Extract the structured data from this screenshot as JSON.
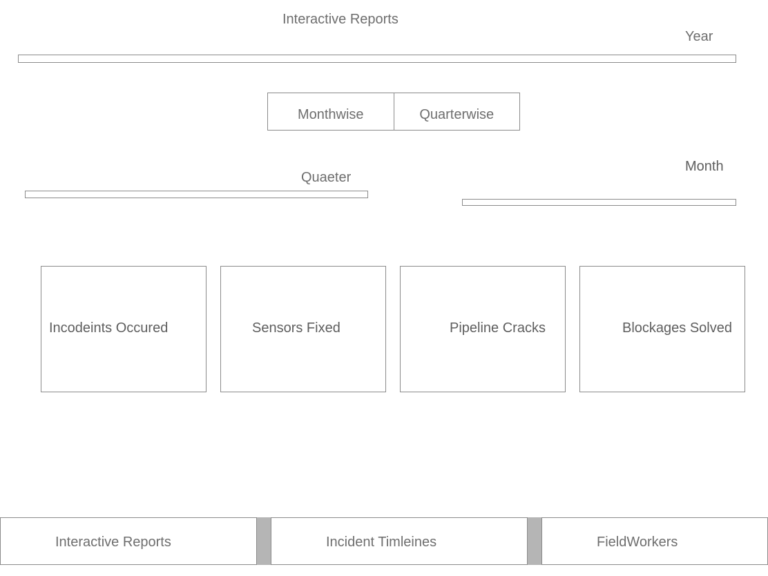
{
  "header": {
    "title": "Interactive Reports"
  },
  "filters": {
    "year_label": "Year",
    "quarter_label": "Quaeter",
    "month_label": "Month"
  },
  "view_toggle": {
    "options": [
      "Monthwise",
      "Quarterwise"
    ]
  },
  "cards": [
    {
      "label": "Incodeints Occured"
    },
    {
      "label": "Sensors Fixed"
    },
    {
      "label": "Pipeline Cracks"
    },
    {
      "label": "Blockages Solved"
    }
  ],
  "bottom_nav": {
    "items": [
      {
        "label": "Interactive Reports"
      },
      {
        "label": "Incident Timleines"
      },
      {
        "label": "FieldWorkers"
      }
    ]
  }
}
